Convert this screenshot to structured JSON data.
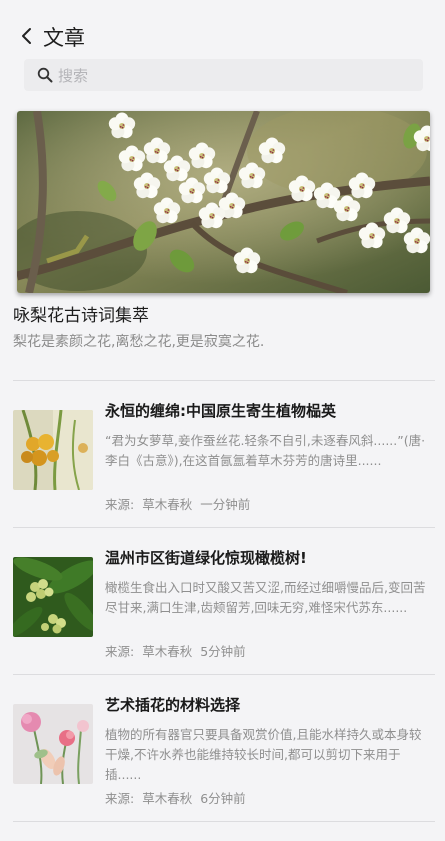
{
  "header": {
    "title": "文章",
    "back_icon": "chevron-left-icon"
  },
  "search": {
    "placeholder": "搜索",
    "value": ""
  },
  "featured": {
    "title": "咏梨花古诗词集萃",
    "subtitle": "梨花是素颜之花,离愁之花,更是寂寞之花."
  },
  "articles": [
    {
      "title": "永恒的缠绵:中国原生寄生植物榀英",
      "summary": "“君为女萝草,妾作蚕丝花.轻条不自引,未逐春风斜......”(唐·李白《古意》),在这首氤氲着草木芬芳的唐诗里......",
      "source_label": "来源:",
      "source": "草木春秋",
      "time": "一分钟前"
    },
    {
      "title": "温州市区街道绿化惊现橄榄树!",
      "summary": "橄榄生食出入口时又酸又苦又涩,而经过细嚼慢品后,变回苦尽甘来,满口生津,齿颊留芳,回味无穷,难怪宋代苏东......",
      "source_label": "来源:",
      "source": "草木春秋",
      "time": "5分钟前"
    },
    {
      "title": "艺术插花的材料选择",
      "summary": "植物的所有器官只要具备观赏价值,且能水样持久或本身较干燥,不许水养也能维持较长时间,都可以剪切下来用于插......",
      "source_label": "来源:",
      "source": "草木春秋",
      "time": "6分钟前"
    }
  ]
}
